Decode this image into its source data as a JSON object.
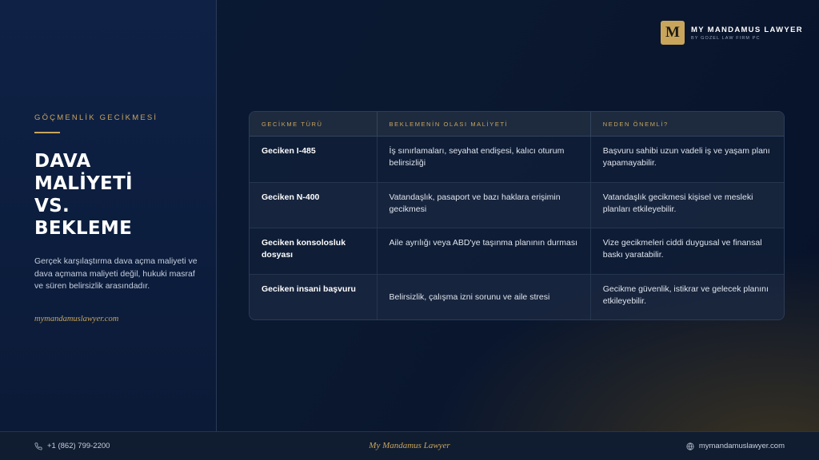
{
  "brand": {
    "mark": "M",
    "name": "MY MANDAMUS LAWYER",
    "subtitle": "BY GOZEL LAW FIRM PC"
  },
  "left": {
    "eyebrow": "GÖÇMENLİK GECİKMESİ",
    "headline": [
      "DAVA",
      "MALİYETİ",
      "VS.",
      "BEKLEME"
    ],
    "description": "Gerçek karşılaştırma dava açma maliyeti ve dava açmama maliyeti değil, hukuki masraf ve süren belirsizlik arasındadır.",
    "site": "mymandamuslawyer.com"
  },
  "table": {
    "headers": [
      "GECİKME TÜRÜ",
      "BEKLEMENİN OLASI MALİYETİ",
      "NEDEN ÖNEMLİ?"
    ],
    "rows": [
      {
        "type": "Geciken I-485",
        "cost": "İş sınırlamaları, seyahat endişesi, kalıcı oturum belirsizliği",
        "why": "Başvuru sahibi uzun vadeli iş ve yaşam planı yapamayabilir."
      },
      {
        "type": "Geciken N-400",
        "cost": "Vatandaşlık, pasaport ve bazı haklara erişimin gecikmesi",
        "why": "Vatandaşlık gecikmesi kişisel ve mesleki planları etkileyebilir."
      },
      {
        "type": "Geciken konsolosluk dosyası",
        "cost": "Aile ayrılığı veya ABD'ye taşınma planının durması",
        "why": "Vize gecikmeleri ciddi duygusal ve finansal baskı yaratabilir."
      },
      {
        "type": "Geciken insani başvuru",
        "cost": "Belirsizlik, çalışma izni sorunu ve aile stresi",
        "why": "Gecikme güvenlik, istikrar ve gelecek planını etkileyebilir."
      }
    ]
  },
  "footer": {
    "phone": "+1 (862) 799-2200",
    "brand": "My Mandamus Lawyer",
    "website": "mymandamuslawyer.com"
  },
  "icons": {
    "phone": "phone-icon",
    "globe": "globe-icon"
  },
  "colors": {
    "accent": "#c9a55c",
    "background": "#0b1a33"
  }
}
